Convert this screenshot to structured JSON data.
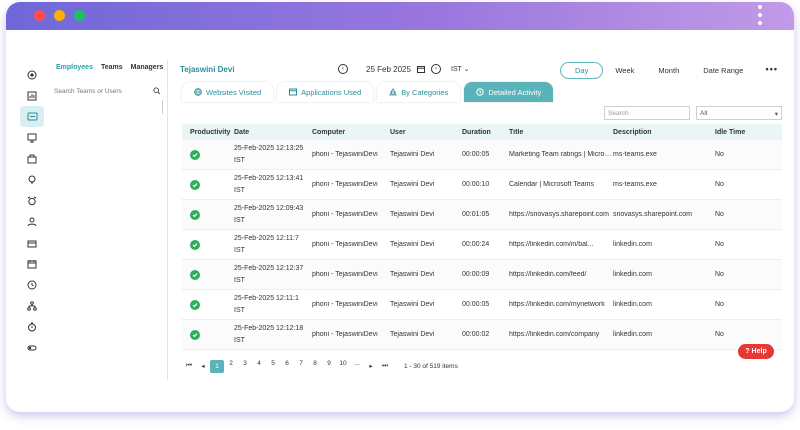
{
  "window": {
    "colors": {
      "close": "#ff4d4d",
      "minimize": "#ffb000",
      "maximize": "#1fbf67",
      "accent": "#5bb3ba",
      "success": "#2eaf5a",
      "help": "#e53935"
    }
  },
  "sidebar": {
    "icons": [
      "target-icon",
      "chart-icon",
      "ticket-icon",
      "monitor-icon",
      "briefcase-icon",
      "lightbulb-icon",
      "alarm-icon",
      "user-icon",
      "bag-icon",
      "calendar-icon",
      "clock-icon",
      "org-chart-icon",
      "timer-icon",
      "toggle-icon"
    ]
  },
  "team_panel": {
    "tabs": [
      "Employees",
      "Teams",
      "Managers"
    ],
    "search_placeholder": "Search Teams or Users"
  },
  "header": {
    "user_name": "Tejaswini Devi",
    "date": "25 Feb 2025",
    "timezone": "IST",
    "periods": [
      "Day",
      "Week",
      "Month",
      "Date Range"
    ],
    "active_period": "Day",
    "more": "•••"
  },
  "tabs": [
    {
      "label": "Websites Visited",
      "icon": "globe-icon"
    },
    {
      "label": "Applications Used",
      "icon": "app-window-icon"
    },
    {
      "label": "By Categories",
      "icon": "categories-icon"
    },
    {
      "label": "Detailed Activity",
      "icon": "clock-icon"
    }
  ],
  "filters": {
    "search_placeholder": "Search",
    "select_value": "All"
  },
  "table": {
    "columns": [
      "Productivity",
      "Date",
      "Computer",
      "User",
      "Duration",
      "Title",
      "Description",
      "Idle Time"
    ],
    "rows": [
      {
        "date1": "25-Feb-2025 12:13:25",
        "date2": "IST",
        "computer": "phoni - TejaswiniDevi",
        "user": "Tejaswini Devi",
        "duration": "00:00:05",
        "title": "Marketing Team ratings | Microsoft Teams",
        "desc": "ms-teams.exe",
        "idle": "No"
      },
      {
        "date1": "25-Feb-2025 12:13:41",
        "date2": "IST",
        "computer": "phoni - TejaswiniDevi",
        "user": "Tejaswini Devi",
        "duration": "00:00:10",
        "title": "Calendar | Microsoft Teams",
        "desc": "ms-teams.exe",
        "idle": "No"
      },
      {
        "date1": "25-Feb-2025 12:09:43",
        "date2": "IST",
        "computer": "phoni - TejaswiniDevi",
        "user": "Tejaswini Devi",
        "duration": "00:01:05",
        "title": "https://snovasys.sharepoint.com",
        "desc": "snovasys.sharepoint.com",
        "idle": "No"
      },
      {
        "date1": "25-Feb-2025 12:11:7",
        "date2": "IST",
        "computer": "phoni - TejaswiniDevi",
        "user": "Tejaswini Devi",
        "duration": "00:00:24",
        "title": "https://linkedin.com/in/bal...",
        "desc": "linkedin.com",
        "idle": "No"
      },
      {
        "date1": "25-Feb-2025 12:12:37",
        "date2": "IST",
        "computer": "phoni - TejaswiniDevi",
        "user": "Tejaswini Devi",
        "duration": "00:00:09",
        "title": "https://linkedin.com/feed/",
        "desc": "linkedin.com",
        "idle": "No"
      },
      {
        "date1": "25-Feb-2025 12:11:1",
        "date2": "IST",
        "computer": "phoni - TejaswiniDevi",
        "user": "Tejaswini Devi",
        "duration": "00:00:05",
        "title": "https://linkedin.com/mynetwork",
        "desc": "linkedin.com",
        "idle": "No"
      },
      {
        "date1": "25-Feb-2025 12:12:18",
        "date2": "IST",
        "computer": "phoni - TejaswiniDevi",
        "user": "Tejaswini Devi",
        "duration": "00:00:02",
        "title": "https://linkedin.com/company",
        "desc": "linkedin.com",
        "idle": "No"
      }
    ]
  },
  "pager": {
    "pages": [
      "1",
      "2",
      "3",
      "4",
      "5",
      "6",
      "7",
      "8",
      "9",
      "10",
      "..."
    ],
    "active": "1",
    "info": "1 - 30 of 519 items"
  },
  "help": {
    "label": "Help"
  }
}
